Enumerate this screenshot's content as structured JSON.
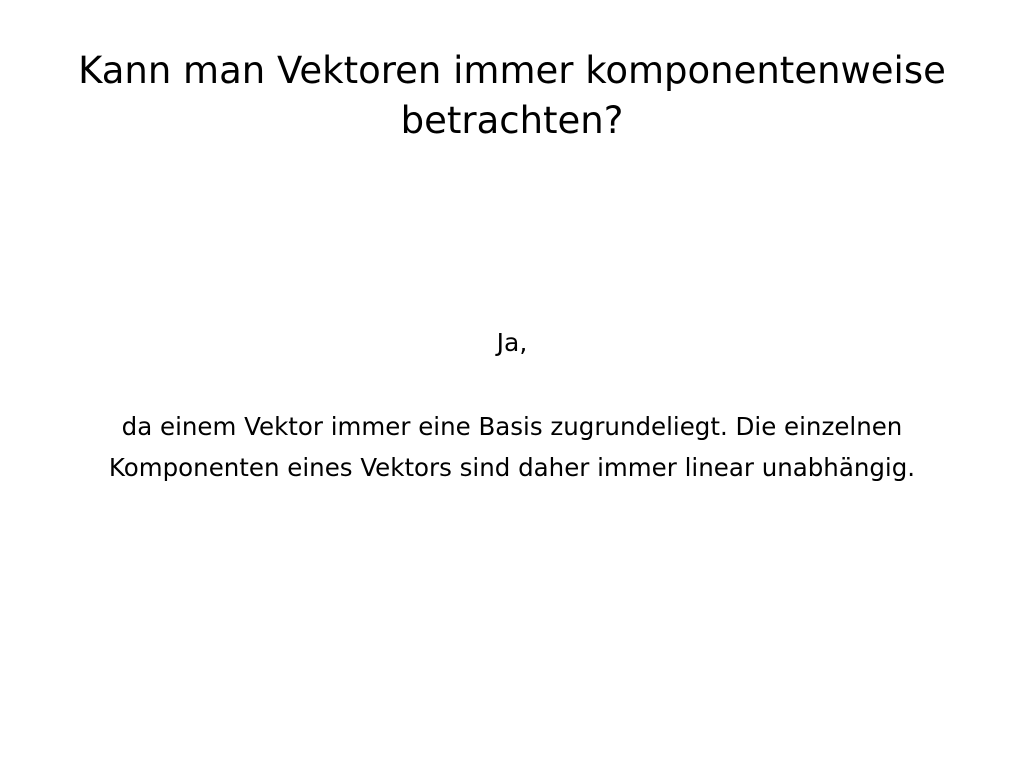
{
  "slide": {
    "title": "Kann man Vektoren immer komponentenweise betrachten?",
    "answer_intro": "Ja,",
    "answer_body": "da einem Vektor immer eine Basis zugrundeliegt. Die einzelnen Komponenten eines Vektors sind daher immer linear unabhängig."
  },
  "colors": {
    "background": "#ffffff",
    "text": "#000000"
  }
}
